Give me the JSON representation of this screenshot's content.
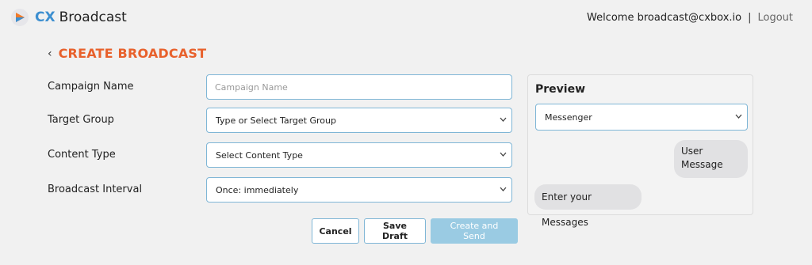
{
  "header": {
    "brand_prefix": "CX",
    "brand_name": "Broadcast",
    "welcome_text": "Welcome broadcast@cxbox.io",
    "separator": "|",
    "logout_label": "Logout"
  },
  "page": {
    "back_glyph": "‹",
    "title": "CREATE BROADCAST"
  },
  "form": {
    "campaign_name": {
      "label": "Campaign Name",
      "placeholder": "Campaign Name",
      "value": ""
    },
    "target_group": {
      "label": "Target Group",
      "value": "Type or Select Target Group"
    },
    "content_type": {
      "label": "Content Type",
      "value": "Select Content Type"
    },
    "broadcast_interval": {
      "label": "Broadcast Interval",
      "value": "Once: immediately"
    }
  },
  "actions": {
    "cancel_label": "Cancel",
    "save_draft_label": "Save Draft",
    "create_send_label": "Create and Send"
  },
  "preview": {
    "title": "Preview",
    "channel_value": "Messenger",
    "user_message": "User Message",
    "enter_messages": "Enter your Messages"
  },
  "icons": {
    "logo": "play-triangle-icon",
    "back": "chevron-left-icon",
    "dropdown": "chevron-down-icon"
  },
  "colors": {
    "accent_title": "#e8612c",
    "brand_blue": "#3d8fd0",
    "field_border": "#7fb6d6",
    "primary_button": "#9acbe3",
    "logo_orange": "#f07a2a"
  }
}
